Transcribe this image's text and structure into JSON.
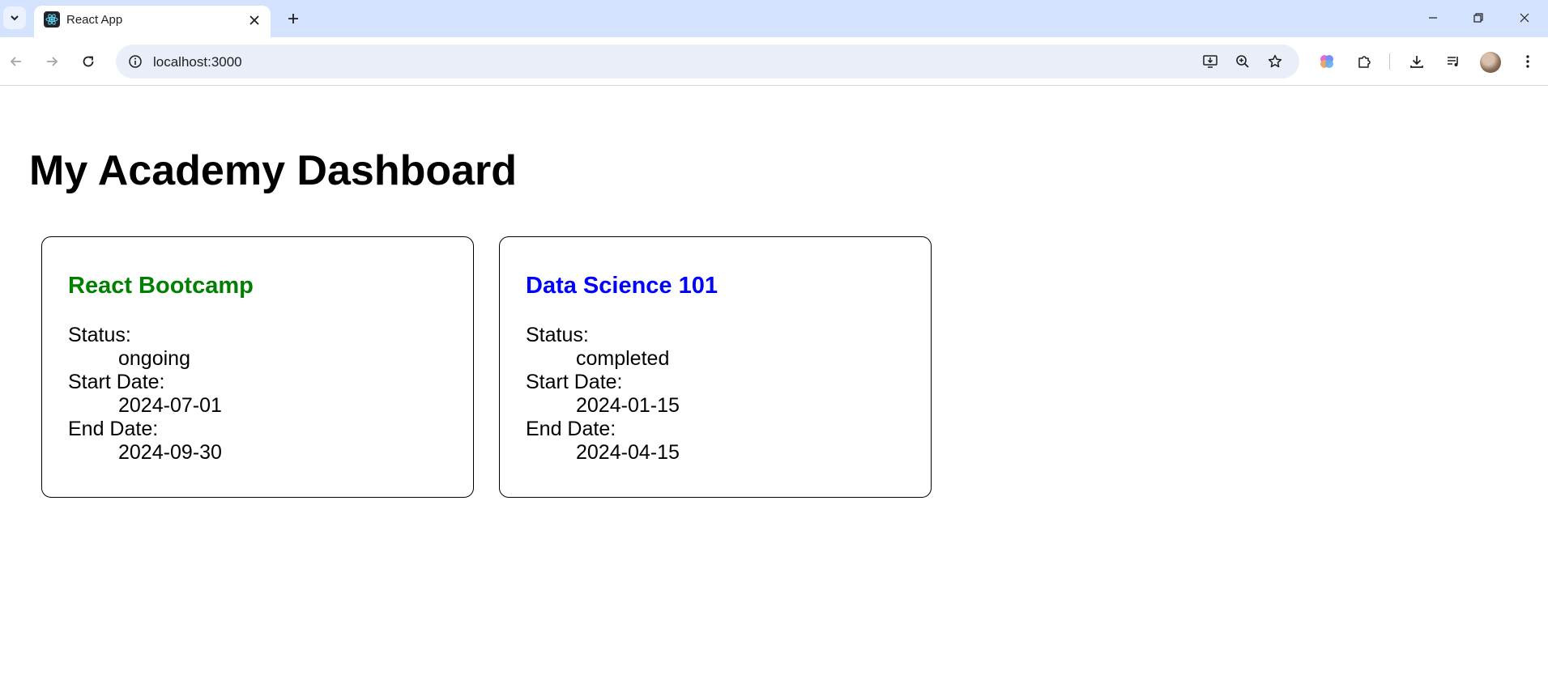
{
  "browser": {
    "tab_title": "React App",
    "url": "localhost:3000",
    "icons": {
      "tab_search": "chevron-down-icon",
      "favicon": "react-logo-icon",
      "tab_close": "close-icon",
      "new_tab": "plus-icon",
      "back": "arrow-left-icon",
      "forward": "arrow-right-icon",
      "reload": "reload-icon",
      "site_info": "info-icon",
      "install": "install-app-icon",
      "zoom": "zoom-icon",
      "bookmark": "star-icon",
      "gemini": "gemini-icon",
      "extensions": "puzzle-icon",
      "downloads": "download-icon",
      "media": "media-control-icon",
      "menu": "kebab-menu-icon"
    }
  },
  "page": {
    "title": "My Academy Dashboard",
    "courses": [
      {
        "name": "React Bootcamp",
        "color": "#008000",
        "status_label": "Status:",
        "status": "ongoing",
        "start_label": "Start Date:",
        "start_date": "2024-07-01",
        "end_label": "End Date:",
        "end_date": "2024-09-30"
      },
      {
        "name": "Data Science 101",
        "color": "#0000ff",
        "status_label": "Status:",
        "status": "completed",
        "start_label": "Start Date:",
        "start_date": "2024-01-15",
        "end_label": "End Date:",
        "end_date": "2024-04-15"
      }
    ]
  }
}
